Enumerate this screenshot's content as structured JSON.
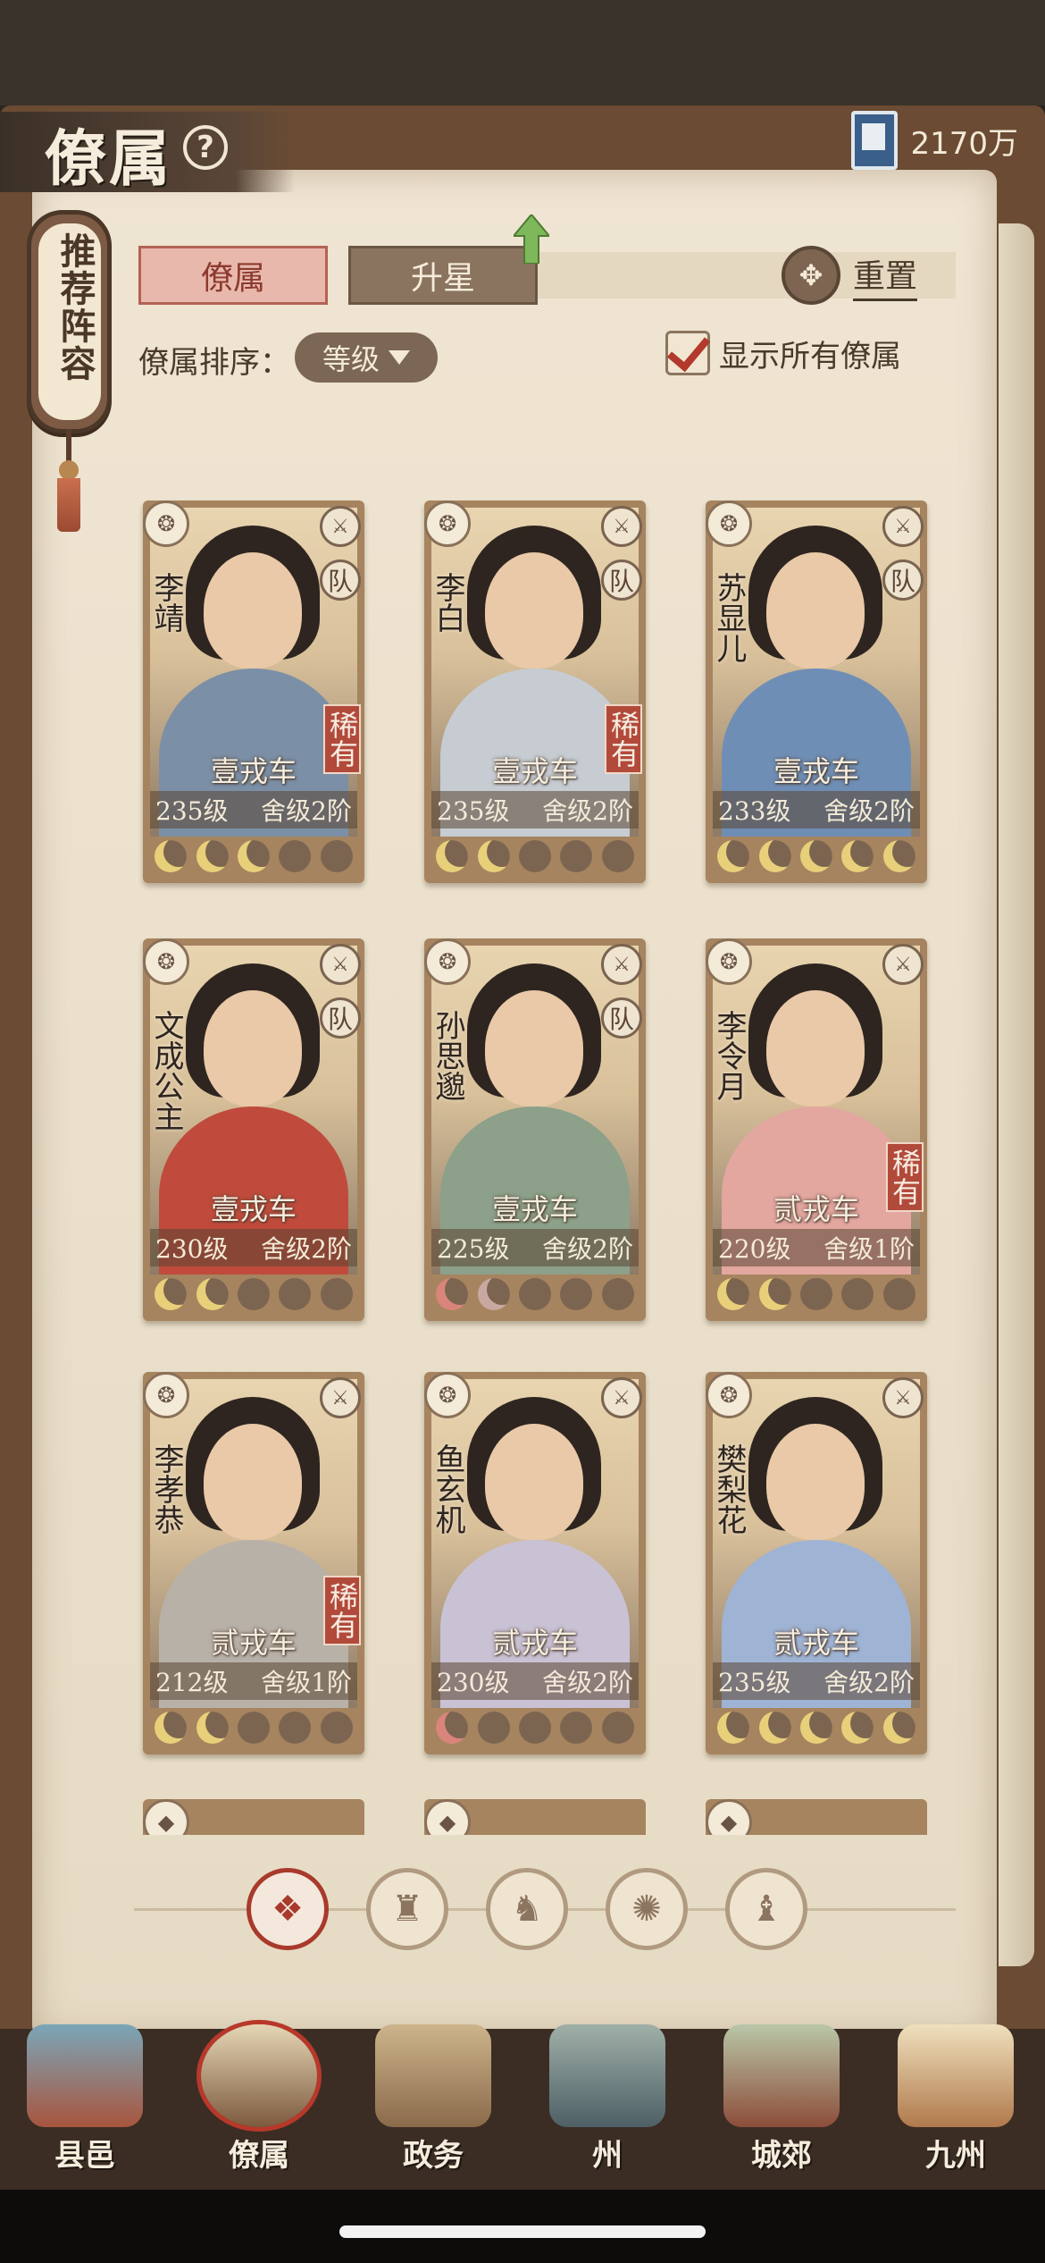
{
  "header": {
    "title": "僚属",
    "currency": "2170万"
  },
  "recommend_tag": "推荐阵容",
  "tabs": [
    {
      "label": "僚属"
    },
    {
      "label": "升星"
    }
  ],
  "reset_label": "重置",
  "sort": {
    "label": "僚属排序：",
    "value": "等级"
  },
  "show_all_label": "显示所有僚属",
  "cards": [
    {
      "name": "李靖",
      "carriage": "壹戎车",
      "level": "235级",
      "stage": "舍级2阶",
      "rare": "稀有",
      "moons": 3,
      "team": "队"
    },
    {
      "name": "李白",
      "carriage": "壹戎车",
      "level": "235级",
      "stage": "舍级2阶",
      "rare": "稀有",
      "moons": 2,
      "team": "队"
    },
    {
      "name": "苏显儿",
      "carriage": "壹戎车",
      "level": "233级",
      "stage": "舍级2阶",
      "rare": "",
      "moons": 5,
      "team": "队"
    },
    {
      "name": "文成公主",
      "carriage": "壹戎车",
      "level": "230级",
      "stage": "舍级2阶",
      "rare": "",
      "moons": 2,
      "team": "队"
    },
    {
      "name": "孙思邈",
      "carriage": "壹戎车",
      "level": "225级",
      "stage": "舍级2阶",
      "rare": "",
      "moons": 2,
      "team": "队"
    },
    {
      "name": "李令月",
      "carriage": "贰戎车",
      "level": "220级",
      "stage": "舍级1阶",
      "rare": "稀有",
      "moons": 2,
      "team": ""
    },
    {
      "name": "李孝恭",
      "carriage": "贰戎车",
      "level": "212级",
      "stage": "舍级1阶",
      "rare": "稀有",
      "moons": 2,
      "team": ""
    },
    {
      "name": "鱼玄机",
      "carriage": "贰戎车",
      "level": "230级",
      "stage": "舍级2阶",
      "rare": "",
      "moons": 1,
      "team": ""
    },
    {
      "name": "樊梨花",
      "carriage": "贰戎车",
      "level": "235级",
      "stage": "舍级2阶",
      "rare": "",
      "moons": 5,
      "team": ""
    }
  ],
  "filters": [
    {
      "icon": "all-icon"
    },
    {
      "icon": "helmet-icon"
    },
    {
      "icon": "cat-icon"
    },
    {
      "icon": "fan-icon"
    },
    {
      "icon": "beast-icon"
    }
  ],
  "nav": [
    {
      "label": "县邑"
    },
    {
      "label": "僚属"
    },
    {
      "label": "政务"
    },
    {
      "label": "州"
    },
    {
      "label": "城郊"
    },
    {
      "label": "九州"
    }
  ]
}
